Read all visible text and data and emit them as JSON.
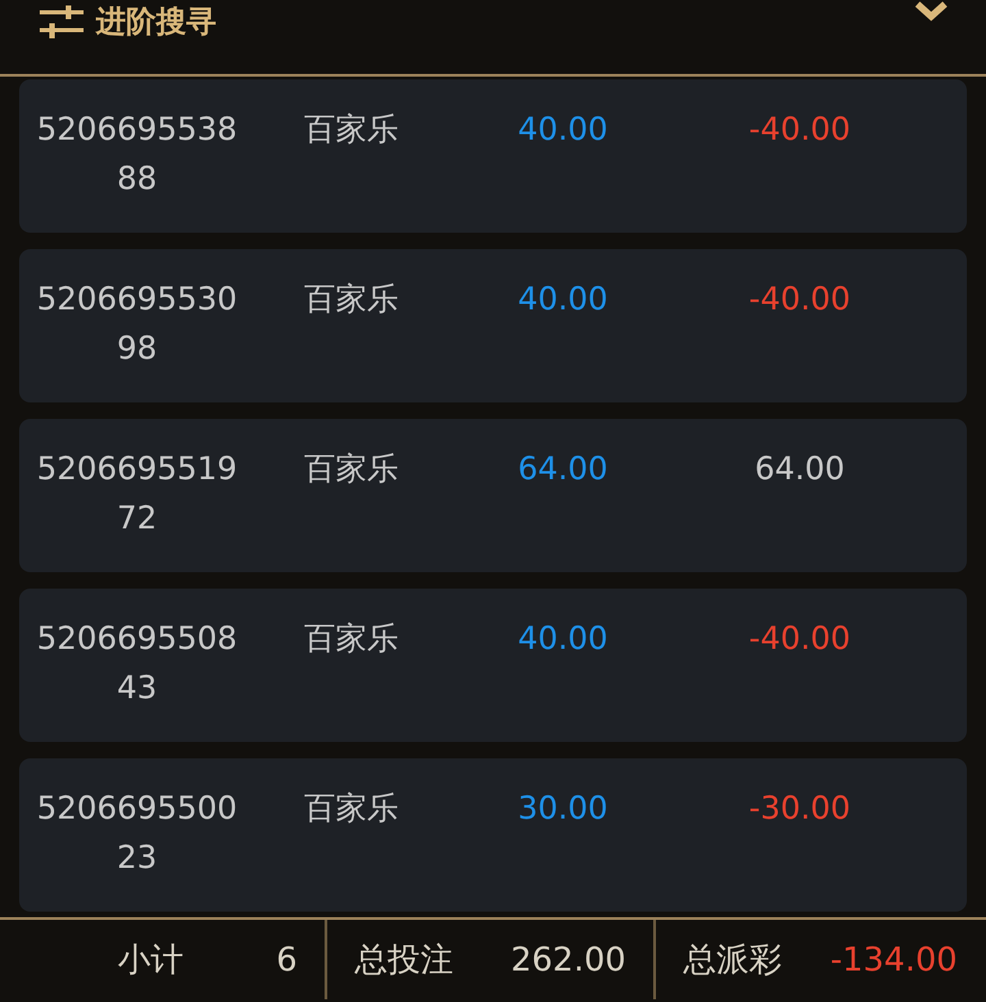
{
  "header": {
    "title": "进阶搜寻"
  },
  "records": [
    {
      "order_id": "520669553888",
      "game": "百家乐",
      "bet": "40.00",
      "payout": "-40.00",
      "color": "#e8412e"
    },
    {
      "order_id": "520669553098",
      "game": "百家乐",
      "bet": "40.00",
      "payout": "-40.00",
      "color": "#e8412e"
    },
    {
      "order_id": "520669551972",
      "game": "百家乐",
      "bet": "64.00",
      "payout": "64.00",
      "color": "#c8c8c8"
    },
    {
      "order_id": "520669550843",
      "game": "百家乐",
      "bet": "40.00",
      "payout": "-40.00",
      "color": "#e8412e"
    },
    {
      "order_id": "520669550023",
      "game": "百家乐",
      "bet": "30.00",
      "payout": "-30.00",
      "color": "#e8412e"
    }
  ],
  "summary": [
    {
      "label": "小计",
      "value": "6",
      "color": "#d8d2c4"
    },
    {
      "label": "总投注",
      "value": "262.00",
      "color": "#d8d2c4"
    },
    {
      "label": "总派彩",
      "value": "-134.00",
      "color": "#e8412e"
    }
  ]
}
